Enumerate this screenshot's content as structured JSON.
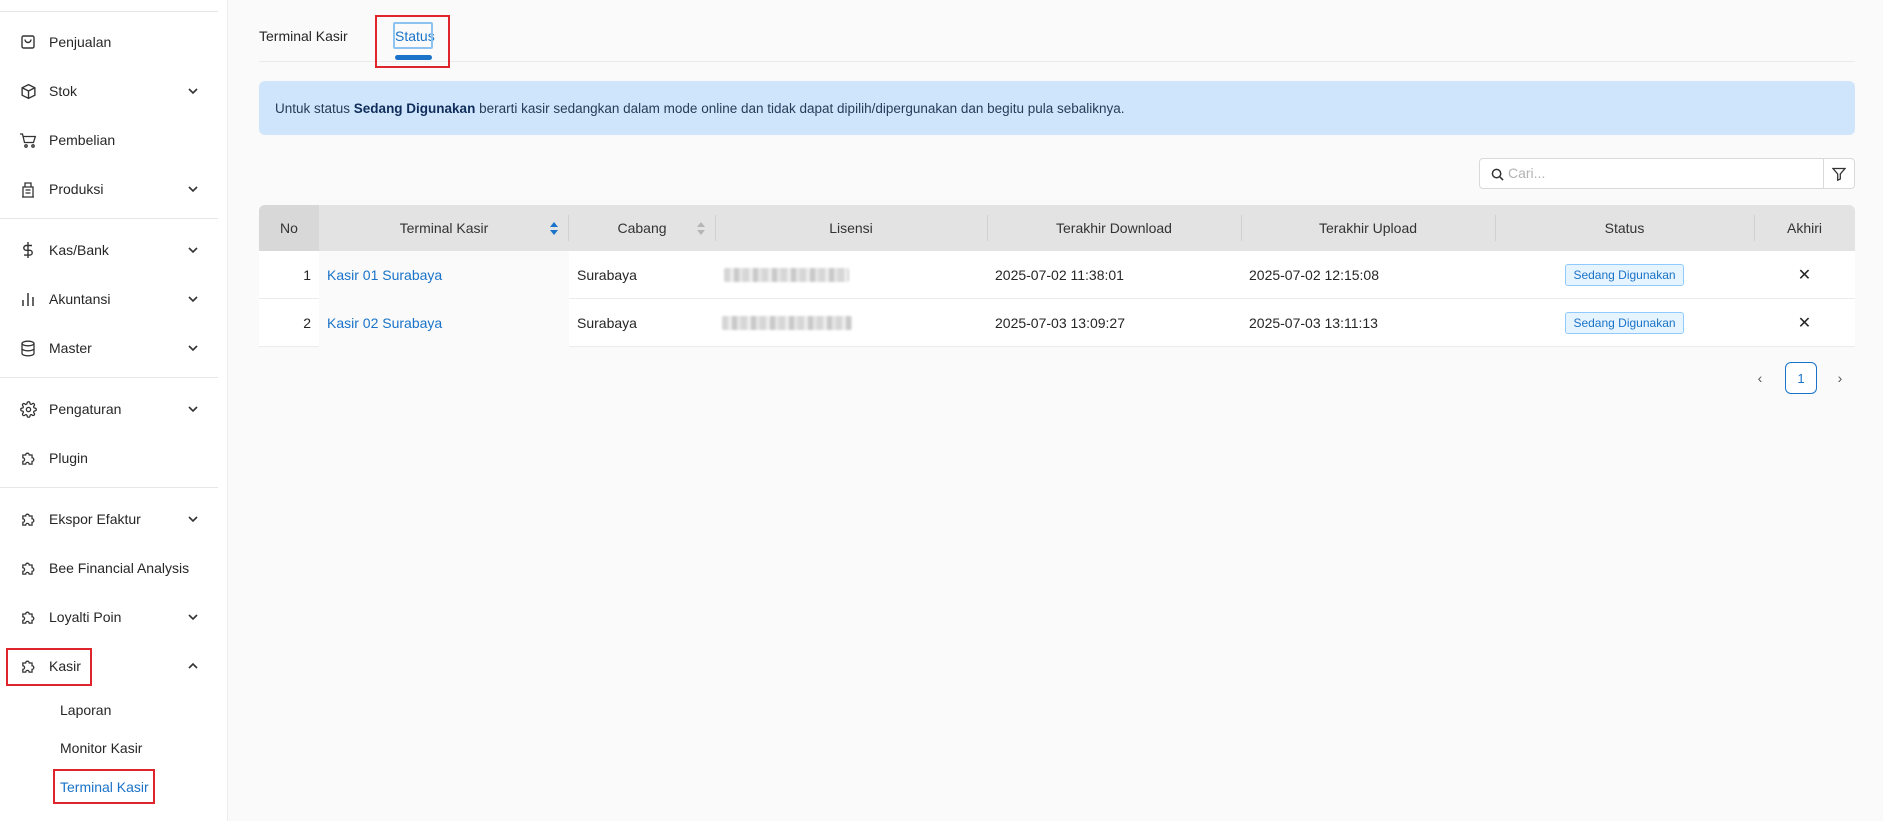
{
  "sidebar": {
    "items": [
      {
        "label": "Penjualan",
        "icon": "shopping-bag-icon"
      },
      {
        "label": "Stok",
        "icon": "box-icon"
      },
      {
        "label": "Pembelian",
        "icon": "cart-icon"
      },
      {
        "label": "Produksi",
        "icon": "factory-icon"
      },
      {
        "label": "Kas/Bank",
        "icon": "dollar-icon"
      },
      {
        "label": "Akuntansi",
        "icon": "bar-chart-icon"
      },
      {
        "label": "Master",
        "icon": "database-icon"
      },
      {
        "label": "Pengaturan",
        "icon": "gear-icon"
      },
      {
        "label": "Plugin",
        "icon": "puzzle-icon"
      },
      {
        "label": "Ekspor Efaktur",
        "icon": "puzzle-icon"
      },
      {
        "label": "Bee Financial Analysis",
        "icon": "puzzle-icon"
      },
      {
        "label": "Loyalti Poin",
        "icon": "puzzle-icon"
      },
      {
        "label": "Kasir",
        "icon": "puzzle-icon"
      }
    ],
    "kasir_sub": [
      "Laporan",
      "Monitor Kasir",
      "Terminal Kasir"
    ]
  },
  "tabs": [
    "Terminal Kasir",
    "Status"
  ],
  "alert": {
    "prefix": "Untuk status ",
    "bold": "Sedang Digunakan",
    "suffix": " berarti kasir sedangkan dalam mode online dan tidak dapat dipilih/dipergunakan dan begitu pula sebaliknya."
  },
  "search": {
    "placeholder": "Cari..."
  },
  "table": {
    "headers": [
      "No",
      "Terminal Kasir",
      "Cabang",
      "Lisensi",
      "Terakhir Download",
      "Terakhir Upload",
      "Status",
      "Akhiri"
    ],
    "rows": [
      {
        "no": "1",
        "terminal": "Kasir 01 Surabaya",
        "cabang": "Surabaya",
        "download": "2025-07-02 11:38:01",
        "upload": "2025-07-02 12:15:08",
        "status": "Sedang Digunakan",
        "akhiri": "✕"
      },
      {
        "no": "2",
        "terminal": "Kasir 02 Surabaya",
        "cabang": "Surabaya",
        "download": "2025-07-03 13:09:27",
        "upload": "2025-07-03 13:11:13",
        "status": "Sedang Digunakan",
        "akhiri": "✕"
      }
    ]
  },
  "pagination": {
    "prev": "‹",
    "current": "1",
    "next": "›"
  },
  "colors": {
    "accent": "#1a73c8",
    "highlight": "#e0242c",
    "alert_bg": "#cfe5fb"
  }
}
